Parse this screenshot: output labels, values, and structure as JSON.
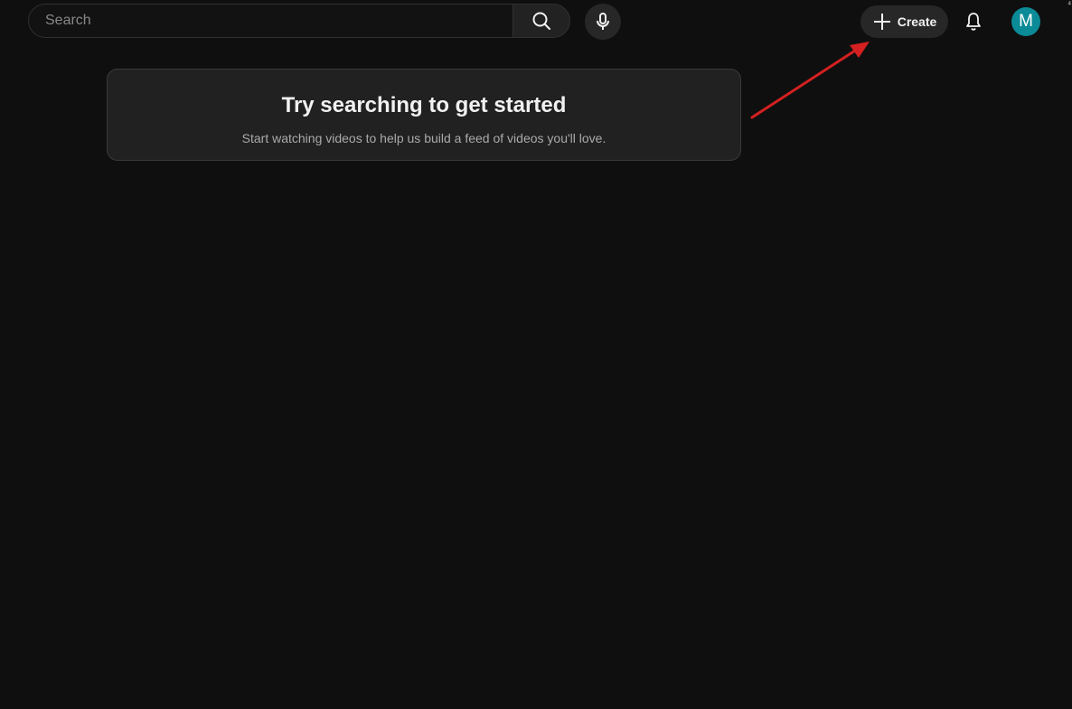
{
  "header": {
    "search": {
      "placeholder": "Search",
      "value": ""
    },
    "search_button_icon": "search-icon",
    "mic_button_icon": "microphone-icon",
    "create_button": {
      "icon": "plus-icon",
      "label": "Create"
    },
    "notifications_icon": "bell-icon",
    "avatar": {
      "initial": "M",
      "color": "#0b8a97"
    }
  },
  "prompt": {
    "title": "Try searching to get started",
    "subtitle": "Start watching videos to help us build a feed of videos you'll love."
  },
  "annotation": {
    "arrow_color": "#d42020"
  },
  "colors": {
    "background": "#0f0f0f",
    "card": "#212121",
    "button": "#272727"
  }
}
